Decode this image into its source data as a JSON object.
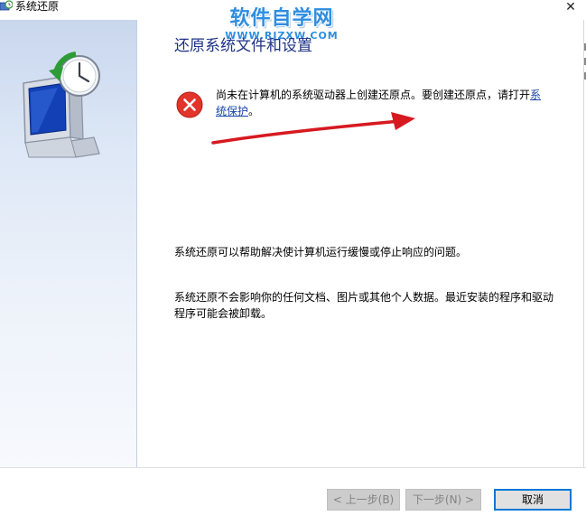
{
  "window": {
    "title": "系统还原",
    "close_glyph": "✕"
  },
  "watermark": {
    "title": "软件自学网",
    "url": "WWW.RJZXW.COM"
  },
  "main": {
    "heading": "还原系统文件和设置",
    "error_text": "尚未在计算机的系统驱动器上创建还原点。要创建还原点，请打开",
    "error_link": "系统保护",
    "error_suffix": "。",
    "description_1": "系统还原可以帮助解决使计算机运行缓慢或停止响应的问题。",
    "description_2": "系统还原不会影响你的任何文档、图片或其他个人数据。最近安装的程序和驱动程序可能会被卸载。"
  },
  "footer": {
    "back_label": "< 上一步(B)",
    "next_label": "下一步(N) >",
    "cancel_label": "取消"
  },
  "icons": {
    "app": "system-restore-icon",
    "error": "error-icon",
    "arrow": "red-arrow",
    "close": "close-icon"
  },
  "colors": {
    "heading": "#1e3287",
    "link": "#1a47a8",
    "error": "#e2342b",
    "arrow": "#d71920",
    "watermark": "#2e8ee0",
    "accent_border": "#0078d7"
  }
}
